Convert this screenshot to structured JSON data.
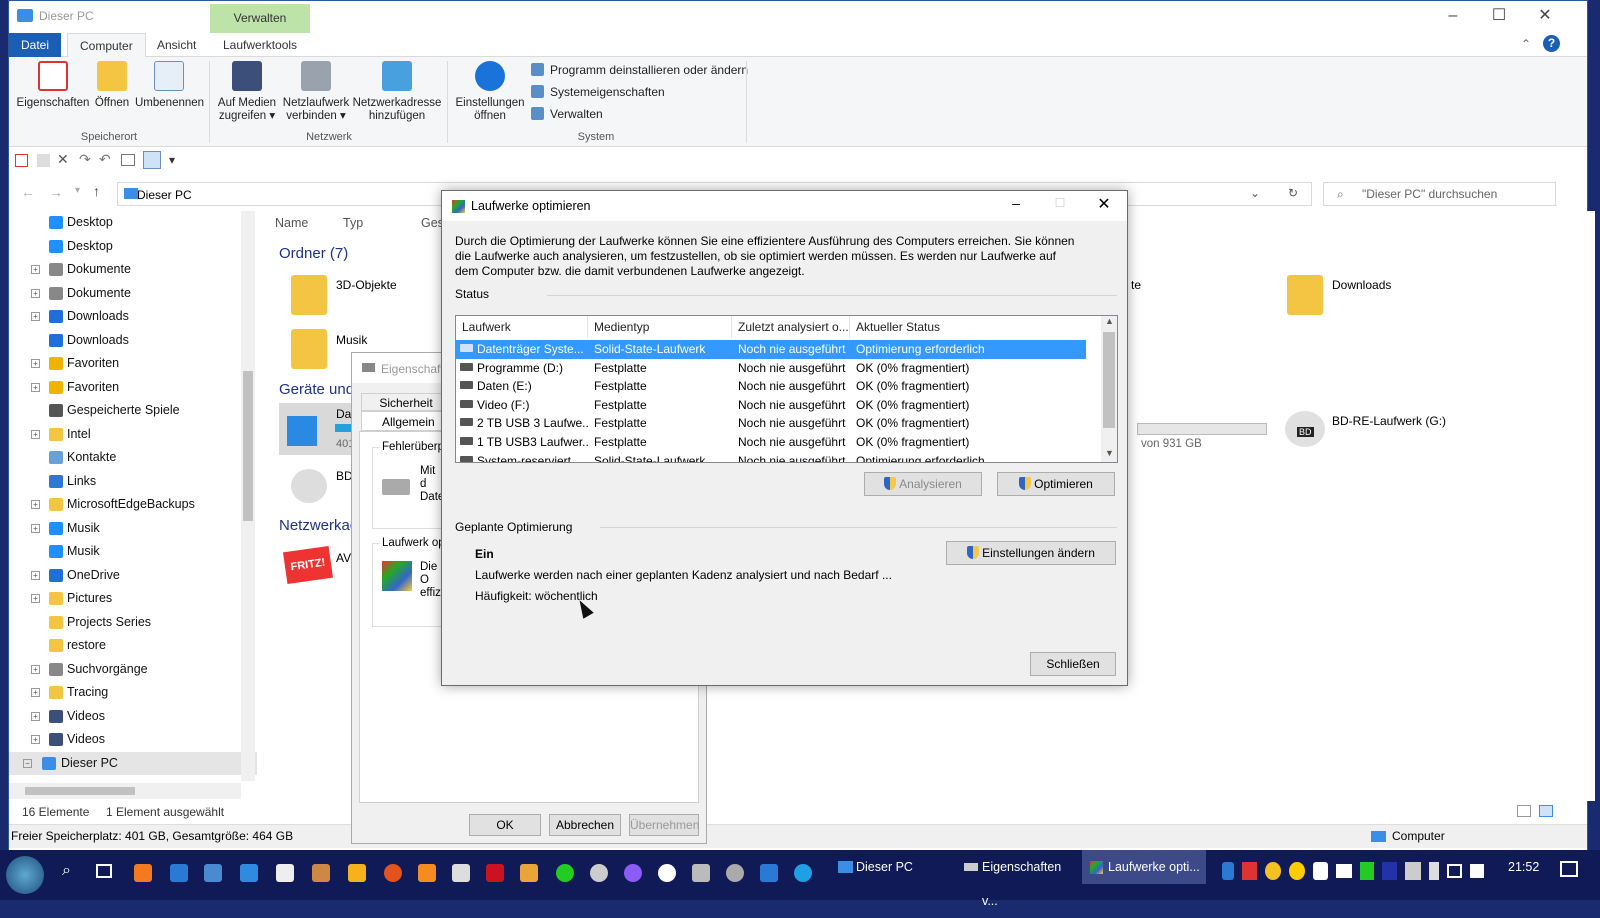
{
  "window": {
    "title": "Dieser PC"
  },
  "ribbon": {
    "context_tab": "Verwalten",
    "tabs": [
      "Datei",
      "Computer",
      "Ansicht",
      "Laufwerktools"
    ],
    "groups": {
      "speicherort": "Speicherort",
      "netzwerk": "Netzwerk",
      "system": "System"
    },
    "buttons": {
      "eigenschaften": "Eigenschaften",
      "oeffnen": "Öffnen",
      "umbenennen": "Umbenennen",
      "medien": "Auf Medien zugreifen",
      "netzlaufwerk": "Netzlaufwerk verbinden",
      "netzwerkadresse": "Netzwerkadresse hinzufügen",
      "einstellungen": "Einstellungen öffnen"
    },
    "system_items": [
      "Programm deinstallieren oder ändern",
      "Systemeigenschaften",
      "Verwalten"
    ]
  },
  "address": {
    "path": "Dieser PC",
    "search_placeholder": "\"Dieser PC\" durchsuchen"
  },
  "nav": {
    "items": [
      "Desktop",
      "Desktop",
      "Dokumente",
      "Dokumente",
      "Downloads",
      "Downloads",
      "Favoriten",
      "Favoriten",
      "Gespeicherte Spiele",
      "Intel",
      "Kontakte",
      "Links",
      "MicrosoftEdgeBackups",
      "Musik",
      "Musik",
      "OneDrive",
      "Pictures",
      "Projects Series",
      "restore",
      "Suchvorgänge",
      "Tracing",
      "Videos",
      "Videos",
      "Dieser PC"
    ]
  },
  "content": {
    "columns": [
      "Name",
      "Typ",
      "Gesa"
    ],
    "group_folders": "Ordner (7)",
    "group_devices": "Geräte und",
    "group_network": "Netzwerkad",
    "folders": [
      "3D-Objekte",
      "Musik",
      "Downloads"
    ],
    "devices": {
      "drive_label": "Date",
      "drive_free": "401 G",
      "bd_short": "BD-R",
      "bd_full": "BD-RE-Laufwerk (G:)",
      "bd_badge": "BD",
      "size_text": "von 931 GB",
      "fritz_label": "AVM",
      "fritz_badge": "FRITZ!"
    },
    "folder_partial": "te"
  },
  "status": {
    "count": "16 Elemente",
    "selected": "1 Element ausgewählt",
    "space": "Freier Speicherplatz: 401 GB, Gesamtgröße: 464 GB",
    "computer": "Computer"
  },
  "props_dialog": {
    "title": "Eigenschaft",
    "tabs": [
      "Sicherheit",
      "Allgemein"
    ],
    "section1": "Fehlerüberprü",
    "section1_text": "Mit d Date",
    "section2": "Laufwerk opt",
    "section2_text": "Die O effizi",
    "buttons": {
      "ok": "OK",
      "cancel": "Abbrechen",
      "apply": "Übernehmen"
    }
  },
  "opt_dialog": {
    "title": "Laufwerke optimieren",
    "intro": "Durch die Optimierung der Laufwerke können Sie eine effizientere Ausführung des Computers erreichen. Sie können die Laufwerke auch analysieren, um festzustellen, ob sie optimiert werden müssen. Es werden nur Laufwerke auf dem Computer bzw. die damit verbundenen Laufwerke angezeigt.",
    "status_label": "Status",
    "columns": [
      "Laufwerk",
      "Medientyp",
      "Zuletzt analysiert o...",
      "Aktueller Status"
    ],
    "rows": [
      {
        "drive": "Datenträger Syste...",
        "media": "Solid-State-Laufwerk",
        "last": "Noch nie ausgeführt",
        "status": "Optimierung erforderlich"
      },
      {
        "drive": "Programme (D:)",
        "media": "Festplatte",
        "last": "Noch nie ausgeführt",
        "status": "OK (0% fragmentiert)"
      },
      {
        "drive": "Daten (E:)",
        "media": "Festplatte",
        "last": "Noch nie ausgeführt",
        "status": "OK (0% fragmentiert)"
      },
      {
        "drive": "Video (F:)",
        "media": "Festplatte",
        "last": "Noch nie ausgeführt",
        "status": "OK (0% fragmentiert)"
      },
      {
        "drive": "2 TB USB 3  Laufwe...",
        "media": "Festplatte",
        "last": "Noch nie ausgeführt",
        "status": "OK (0% fragmentiert)"
      },
      {
        "drive": "1 TB USB3  Laufwer...",
        "media": "Festplatte",
        "last": "Noch nie ausgeführt",
        "status": "OK (0% fragmentiert)"
      },
      {
        "drive": "System-reserviert",
        "media": "Solid-State-Laufwerk",
        "last": "Noch nie ausgeführt",
        "status": "Optimierung erforderlich"
      }
    ],
    "analyze": "Analysieren",
    "optimize": "Optimieren",
    "scheduled_label": "Geplante Optimierung",
    "scheduled_state": "Ein",
    "scheduled_desc": "Laufwerke werden nach einer geplanten Kadenz analysiert und nach Bedarf ...",
    "frequency": "Häufigkeit: wöchentlich",
    "change_settings": "Einstellungen ändern",
    "close": "Schließen"
  },
  "taskbar": {
    "apps": [
      "Dieser PC",
      "Eigenschaften v...",
      "Laufwerke opti..."
    ],
    "clock": "21:52"
  }
}
